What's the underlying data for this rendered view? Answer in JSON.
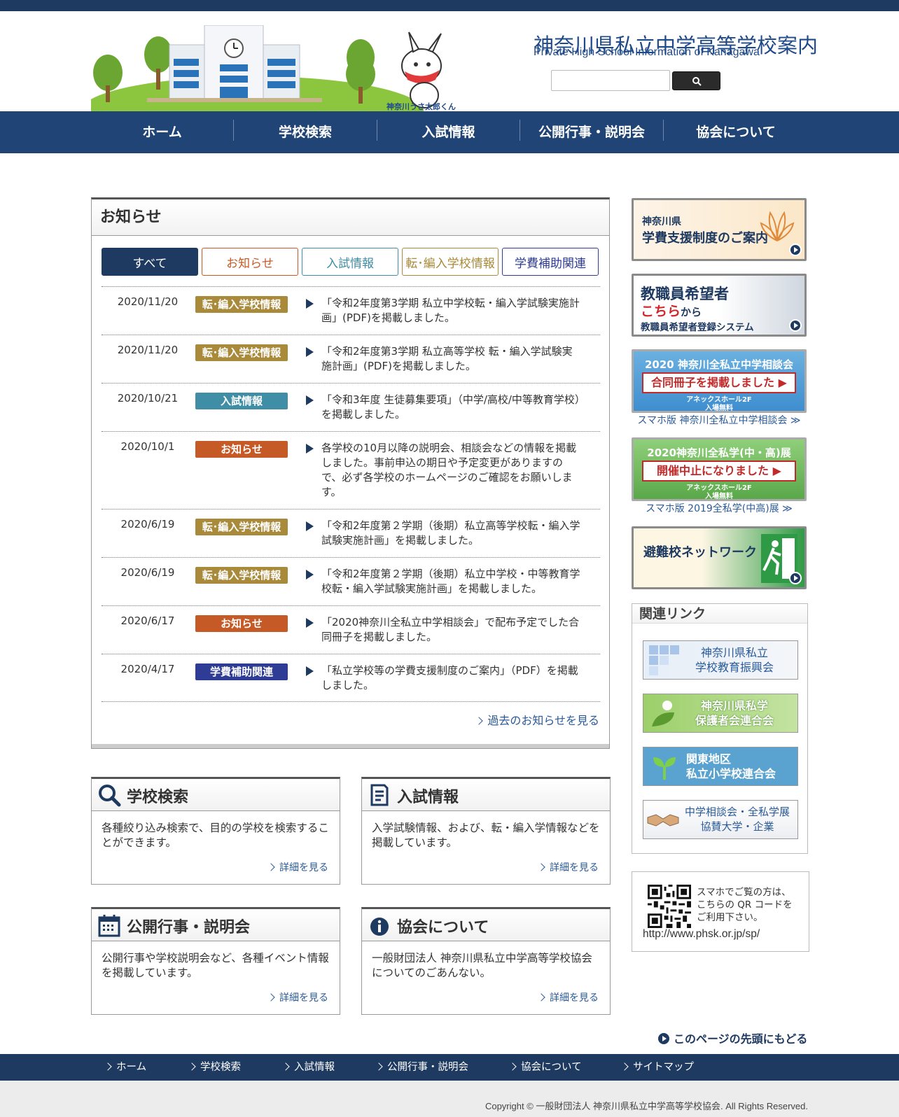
{
  "header": {
    "title": "神奈川県私立中学高等学校案内",
    "subtitle": "Private High School Information of Kanagawa",
    "mascot_caption": "神奈川うさ太郎くん",
    "search": {
      "placeholder": "",
      "button_icon": "search-icon"
    }
  },
  "nav": {
    "items": [
      {
        "label": "ホーム"
      },
      {
        "label": "学校検索"
      },
      {
        "label": "入試情報"
      },
      {
        "label": "公開行事・説明会"
      },
      {
        "label": "協会について"
      }
    ]
  },
  "news": {
    "title": "お知らせ",
    "tabs": [
      {
        "label": "すべて"
      },
      {
        "label": "お知らせ"
      },
      {
        "label": "入試情報"
      },
      {
        "label": "転･編入学校情報"
      },
      {
        "label": "学費補助関連"
      }
    ],
    "items": [
      {
        "date": "2020/11/20",
        "badge": "転･編入学校情報",
        "badge_color": "#a98a3a",
        "text": "「令和2年度第3学期 私立中学校転・編入学試験実施計画」(PDF)を掲載しました。"
      },
      {
        "date": "2020/11/20",
        "badge": "転･編入学校情報",
        "badge_color": "#a98a3a",
        "text": "「令和2年度第3学期 私立高等学校 転・編入学試験実施計画」(PDF)を掲載しました。"
      },
      {
        "date": "2020/10/21",
        "badge": "入試情報",
        "badge_color": "#3f8ea5",
        "text": "「令和3年度 生徒募集要項」（中学/高校/中等教育学校）を掲載しました。"
      },
      {
        "date": "2020/10/1",
        "badge": "お知らせ",
        "badge_color": "#c65a26",
        "text": "各学校の10月以降の説明会、相談会などの情報を掲載しました。事前申込の期日や予定変更がありますので、必ず各学校のホームページのご確認をお願いします。"
      },
      {
        "date": "2020/6/19",
        "badge": "転･編入学校情報",
        "badge_color": "#a98a3a",
        "text": "「令和2年度第２学期（後期）私立高等学校転・編入学試験実施計画」を掲載しました。"
      },
      {
        "date": "2020/6/19",
        "badge": "転･編入学校情報",
        "badge_color": "#a98a3a",
        "text": "「令和2年度第２学期（後期）私立中学校・中等教育学校転・編入学試験実施計画」を掲載しました。"
      },
      {
        "date": "2020/6/17",
        "badge": "お知らせ",
        "badge_color": "#c65a26",
        "text": "「2020神奈川全私立中学相談会」で配布予定でした合同冊子を掲載しました。"
      },
      {
        "date": "2020/4/17",
        "badge": "学費補助関連",
        "badge_color": "#2f3c96",
        "text": "「私立学校等の学費支援制度のご案内」（PDF）を掲載しました。"
      }
    ],
    "more_label": "過去のお知らせを見る"
  },
  "cards": [
    {
      "title": "学校検索",
      "icon": "magnifier-icon",
      "body": "各種絞り込み検索で、目的の学校を検索することができます。",
      "link": "詳細を見る"
    },
    {
      "title": "入試情報",
      "icon": "document-icon",
      "body": "入学試験情報、および、転・編入学情報などを掲載しています。",
      "link": "詳細を見る"
    },
    {
      "title": "公開行事・説明会",
      "icon": "calendar-icon",
      "body": "公開行事や学校説明会など、各種イベント情報を掲載しています。",
      "link": "詳細を見る"
    },
    {
      "title": "協会について",
      "icon": "info-icon",
      "body": "一般財団法人 神奈川県私立中学高等学校協会についてのごあんない。",
      "link": "詳細を見る"
    }
  ],
  "sidebar": {
    "banners": [
      {
        "line1": "神奈川県",
        "line2": "学費支援制度のご案内"
      },
      {
        "line1": "教職員希望者",
        "line2": "こちら",
        "line2b": "から",
        "line3": "教職員希望者登録システム"
      },
      {
        "title": "2020 神奈川全私立中学相談会",
        "notice": "合同冊子を掲載しました ▶",
        "venue": "アネックスホール2F",
        "fee": "入場無料",
        "link": "スマホ版 神奈川全私立中学相談会 ≫"
      },
      {
        "title": "2020神奈川全私学(中・高)展",
        "notice": "開催中止になりました ▶",
        "venue": "アネックスホール2F",
        "fee": "入場無料",
        "link": "スマホ版 2019全私学(中高)展 ≫"
      },
      {
        "line1": "避難校ネットワーク"
      }
    ],
    "related_title": "関連リンク",
    "related": [
      {
        "label1": "神奈川県私立",
        "label2": "学校教育振興会"
      },
      {
        "label1": "神奈川県私学",
        "label2": "保護者会連合会"
      },
      {
        "label1": "関東地区",
        "label2": "私立小学校連合会"
      },
      {
        "label1": "中学相談会・全私学展",
        "label2": "協賛大学・企業"
      }
    ],
    "qr": {
      "line1": "スマホでご覧の方は、",
      "line2": "こちらの QR コードを",
      "line3": "ご利用下さい。",
      "url": "http://www.phsk.or.jp/sp/"
    }
  },
  "to_top": "このページの先頭にもどる",
  "footer": {
    "nav": [
      {
        "label": "ホーム"
      },
      {
        "label": "学校検索"
      },
      {
        "label": "入試情報"
      },
      {
        "label": "公開行事・説明会"
      },
      {
        "label": "協会について"
      },
      {
        "label": "サイトマップ"
      }
    ],
    "copyright": "Copyright © 一般財団法人 神奈川県私立中学高等学校協会. All Rights Reserved."
  }
}
